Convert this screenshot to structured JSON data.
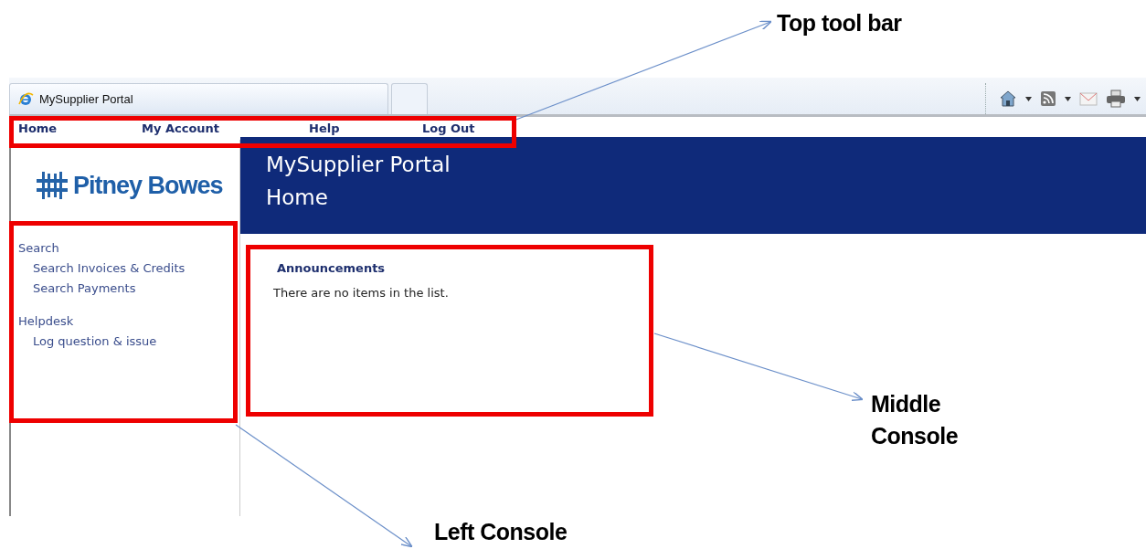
{
  "browser": {
    "tabs": [
      {
        "title": "MySupplier Portal",
        "selected": true
      },
      {
        "selected": false
      }
    ]
  },
  "nav": {
    "links": [
      "Home",
      "My Account",
      "Help",
      "Log Out"
    ]
  },
  "logo": {
    "text": "Pitney Bowes"
  },
  "sidebar": {
    "sections": [
      {
        "label": "Search",
        "children": [
          {
            "label": "Search Invoices & Credits"
          },
          {
            "label": "Search Payments"
          }
        ]
      },
      {
        "label": "Helpdesk",
        "children": [
          {
            "label": "Log question & issue"
          }
        ]
      }
    ]
  },
  "banner": {
    "title": "MySupplier Portal",
    "subtitle": "Home"
  },
  "announcements": {
    "heading": "Announcements",
    "message": "There are no items in the list."
  },
  "annotations": [
    {
      "kind": "topbar",
      "label": "Top tool bar"
    },
    {
      "kind": "middle",
      "label": "Middle Console"
    },
    {
      "kind": "left",
      "label": "Left Console"
    }
  ]
}
